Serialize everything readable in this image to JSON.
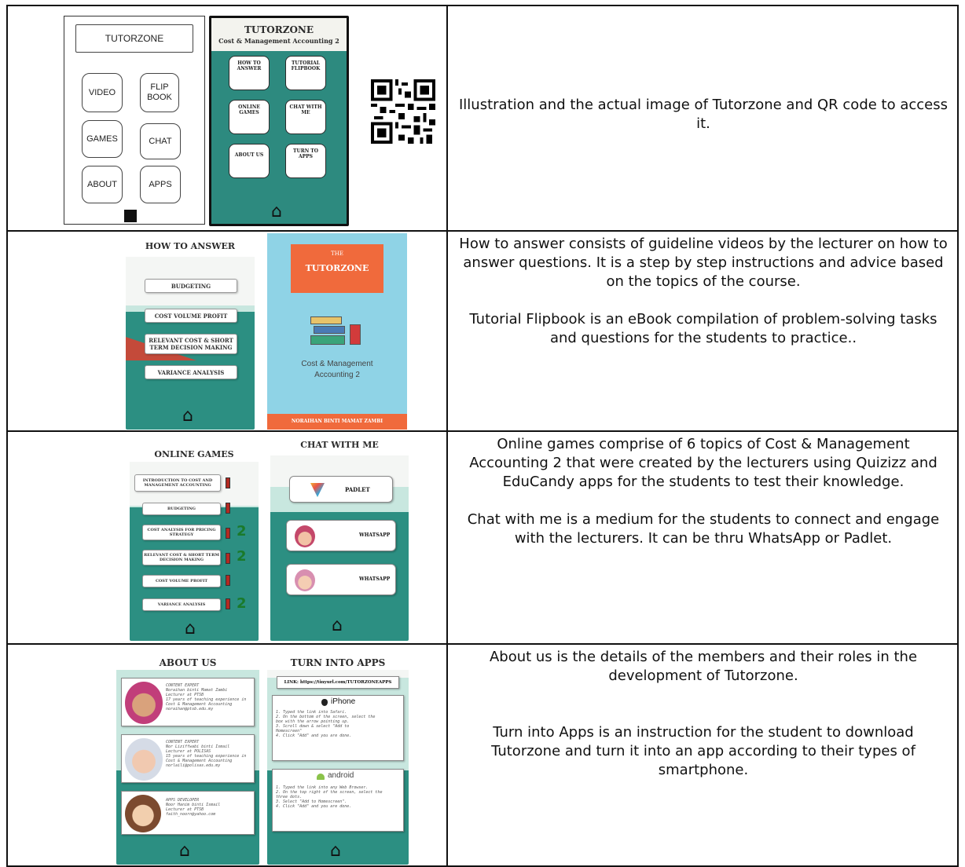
{
  "rows": [
    {
      "description": "Illustration and the actual image of Tutorzone and QR code to access it.",
      "sketch": {
        "title": "TUTORZONE",
        "buttons": [
          "VIDEO",
          "FLIP BOOK",
          "GAMES",
          "CHAT",
          "ABOUT",
          "APPS"
        ]
      },
      "app": {
        "title": "TUTORZONE",
        "subtitle": "Cost & Management Accounting 2",
        "tiles": [
          "HOW TO ANSWER",
          "TUTORIAL FLIPBOOK",
          "ONLINE GAMES",
          "CHAT WITH ME",
          "ABOUT US",
          "TURN TO APPS"
        ]
      }
    },
    {
      "description_1": "How to answer consists of guideline videos by the lecturer on how to answer questions. It is a step by step instructions and advice based on the topics of the course.",
      "description_2": "Tutorial Flipbook is an eBook compilation of problem-solving tasks and questions for the students to practice..",
      "how_to_answer": {
        "title": "HOW TO ANSWER",
        "items": [
          "BUDGETING",
          "COST VOLUME PROFIT",
          "RELEVANT COST & SHORT TERM DECISION MAKING",
          "VARIANCE ANALYSIS"
        ]
      },
      "book": {
        "the": "THE",
        "title": "TUTORZONE",
        "subtitle": "Cost & Management Accounting 2",
        "author": "NORAIHAN BINTI MAMAT ZAMBI"
      }
    },
    {
      "description_1": "Online games comprise of 6 topics of Cost & Management Accounting 2 that were created by the lecturers using Quizizz and EduCandy apps for the students to test their knowledge.",
      "description_2": "Chat with me is a medium for the students to connect and engage with the lecturers. It can be thru WhatsApp or Padlet.",
      "games": {
        "title": "ONLINE GAMES",
        "items": [
          "INTRODUCTION TO COST AND MANAGEMENT ACCOUNTING",
          "BUDGETING",
          "COST ANALYSIS FOR PRICING STRATEGY",
          "RELEVANT COST & SHORT TERM DECISION MAKING",
          "COST VOLUME PROFIT",
          "VARIANCE ANALYSIS"
        ],
        "badge": "2"
      },
      "chat": {
        "title": "CHAT WITH ME",
        "padlet": "PADLET",
        "whatsapp": "WHATSAPP"
      }
    },
    {
      "description_1": "About us is the details of the members and their roles in the development of Tutorzone.",
      "description_2": "Turn into Apps is an instruction for the student to download Tutorzone and turn it into an app according to their types of smartphone.",
      "about": {
        "title": "ABOUT US",
        "members": [
          "CONTENT EXPERT\nNoraihan binti Mamat Zambi\nLecturer at PTSB\n17 years of teaching experience in\nCost & Management Accounting\nnoraihan@ptsb.edu.my",
          "CONTENT EXPERT\nNor Liziffwabi binti Ismail\nLecturer at POLISAS\n15 years of teaching experience in\nCost & Management Accounting\nnorlaili@polisas.edu.my",
          "APPS DEVELOPER\nNoor Hanim binti Ismail\nLecturer at PTSB\nfaith_noorn@yahoo.com"
        ]
      },
      "apps": {
        "title": "TURN INTO APPS",
        "link": "LINK: https://tinyurl.com/TUTORZONEAPPS",
        "iphone": "iPhone",
        "iphone_steps": "1. Typed the link into Safari.\n2. On the bottom of the screen, select the\nbox with the arrow pointing up.\n3. Scroll down & select \"Add to\nHomescreen\"\n4. Click \"Add\" and you are done.",
        "android": "android",
        "android_steps": "1. Typed the link into any Web Browser.\n2. On the top right of the screen, select the\nthree dots.\n3. Select \"Add to Homescreen\".\n4. Click \"Add\" and you are done."
      }
    }
  ]
}
